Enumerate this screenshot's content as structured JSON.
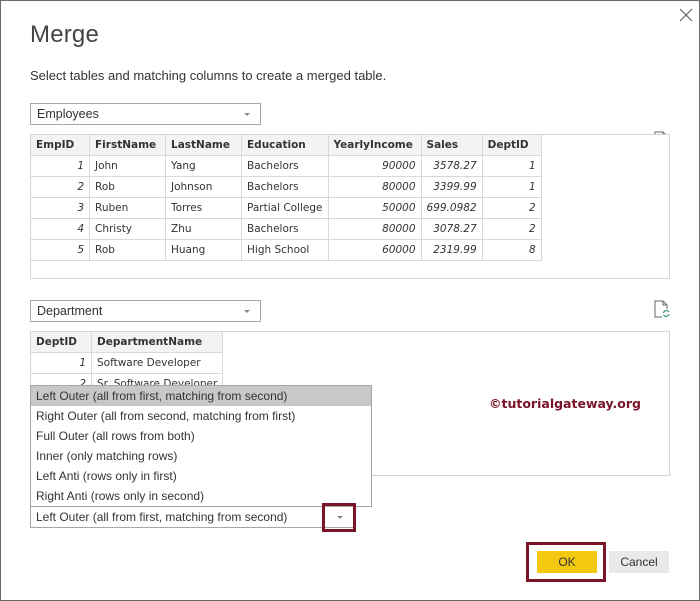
{
  "dialog": {
    "title": "Merge",
    "subtitle": "Select tables and matching columns to create a merged table.",
    "close_icon": "close-icon",
    "watermark": "©tutorialgateway.org"
  },
  "first_table": {
    "selected": "Employees",
    "refresh_icon": "refresh-preview-icon",
    "columns": [
      "EmpID",
      "FirstName",
      "LastName",
      "Education",
      "YearlyIncome",
      "Sales",
      "DeptID"
    ],
    "rows": [
      [
        "1",
        "John",
        "Yang",
        "Bachelors",
        "90000",
        "3578.27",
        "1"
      ],
      [
        "2",
        "Rob",
        "Johnson",
        "Bachelors",
        "80000",
        "3399.99",
        "1"
      ],
      [
        "3",
        "Ruben",
        "Torres",
        "Partial College",
        "50000",
        "699.0982",
        "2"
      ],
      [
        "4",
        "Christy",
        "Zhu",
        "Bachelors",
        "80000",
        "3078.27",
        "2"
      ],
      [
        "5",
        "Rob",
        "Huang",
        "High School",
        "60000",
        "2319.99",
        "8"
      ]
    ]
  },
  "second_table": {
    "selected": "Department",
    "refresh_icon": "refresh-preview-icon",
    "columns": [
      "DeptID",
      "DepartmentName"
    ],
    "rows": [
      [
        "1",
        "Software Developer"
      ],
      [
        "2",
        "Sr. Software Developer"
      ]
    ]
  },
  "join_kind": {
    "selected": "Left Outer (all from first, matching from second)",
    "options": [
      "Left Outer (all from first, matching from second)",
      "Right Outer (all from second, matching from first)",
      "Full Outer (all rows from both)",
      "Inner (only matching rows)",
      "Left Anti (rows only in first)",
      "Right Anti (rows only in second)"
    ],
    "highlighted_index": 0
  },
  "buttons": {
    "ok": "OK",
    "cancel": "Cancel"
  },
  "colors": {
    "ok_button": "#f2c811",
    "highlight_border": "#7a1428",
    "watermark": "#7a1428"
  }
}
